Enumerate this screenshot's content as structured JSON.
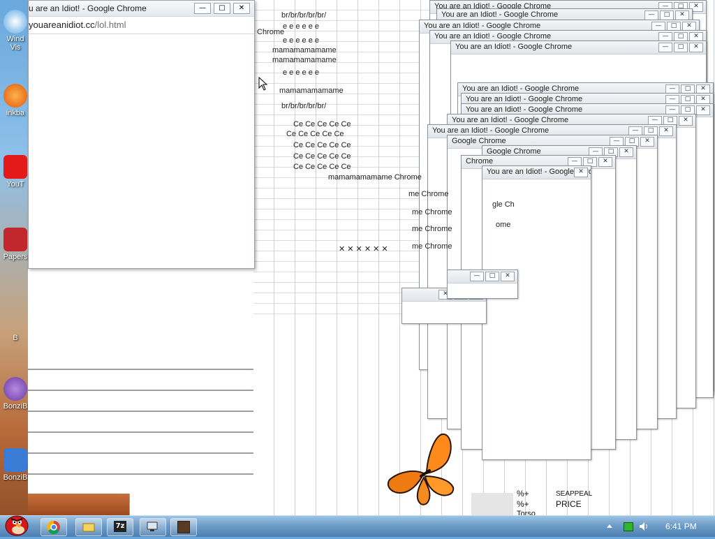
{
  "main_window": {
    "title": "u are an Idiot! - Google Chrome",
    "url_domain": "youareanidiot.cc",
    "url_path": "/lol.html",
    "min_btn": "—",
    "max_btn": "□",
    "close_btn": "✕"
  },
  "popup_title": "You are an Idiot! - Google Chrome",
  "popup_title_short": "Google Chrome",
  "fragments": {
    "chrome": "Chrome",
    "e_row": "e e e e e e",
    "m_row": "mamamamamame",
    "br_row": "br/br/br/br/br/",
    "ce_row": "Ce Ce Ce Ce Ce",
    "me_row": "me Chrome",
    "mama_row": "mamamamamame Chrome",
    "x_row": "✕ ✕ ✕ ✕ ✕ ✕",
    "gle": "gle Ch",
    "ome": "ome"
  },
  "desktop_icons": [
    {
      "label": "Wind",
      "label2": "Vis"
    },
    {
      "label": "inkba"
    },
    {
      "label": "YouT"
    },
    {
      "label": "Papers"
    },
    {
      "label": "B"
    },
    {
      "label": "BonziB"
    },
    {
      "label": "BonziB"
    }
  ],
  "bottom_text": {
    "pct1": "%+",
    "pct2": "%+",
    "torso": "Torso",
    "price": "PRICE",
    "seaweal": "SEAPPEAL"
  },
  "taskbar": {
    "time": "6:41 PM"
  },
  "colors": {
    "taskbar": "#6d9cc8",
    "window_bg": "#ffffff",
    "titlebar": "#e6e9ee"
  }
}
